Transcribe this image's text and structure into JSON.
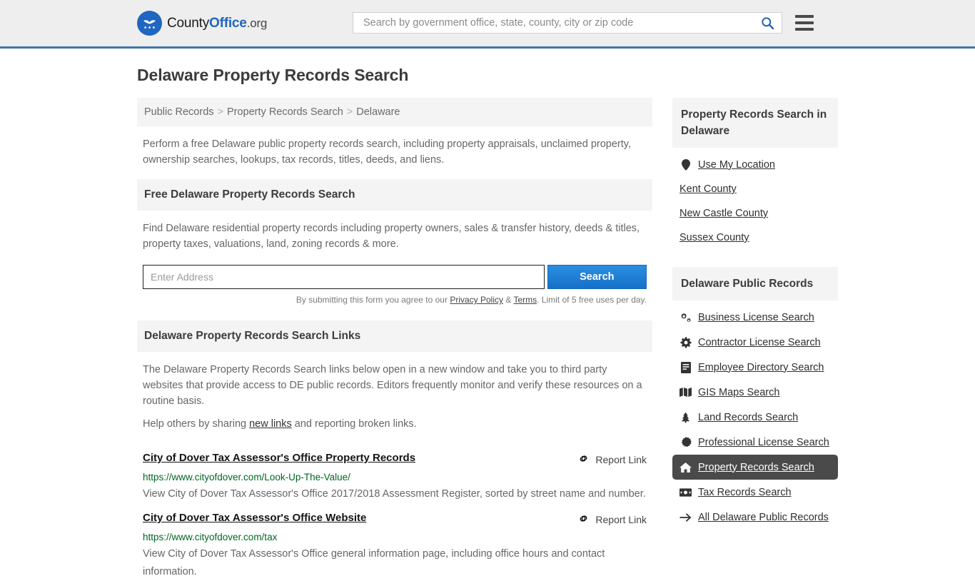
{
  "header": {
    "logo": {
      "icon": "eagle-shield-logo",
      "text_1": "County",
      "text_2": "Office",
      "text_3": ".org"
    },
    "search": {
      "placeholder": "Search by government office, state, county, city or zip code",
      "value": "",
      "icon": "search-icon"
    },
    "menu_icon": "hamburger-menu-icon",
    "accent_color": "#3a77ad"
  },
  "page": {
    "title": "Delaware Property Records Search"
  },
  "breadcrumb": {
    "items": [
      {
        "label": "Public Records"
      },
      {
        "label": "Property Records Search"
      },
      {
        "label": "Delaware"
      }
    ],
    "separator": ">"
  },
  "intro": {
    "text": "Perform a free Delaware public property records search, including property appraisals, unclaimed property, ownership searches, lookups, tax records, titles, deeds, and liens."
  },
  "free_search": {
    "heading": "Free Delaware Property Records Search",
    "description": "Find Delaware residential property records including property owners, sales & transfer history, deeds & titles, property taxes, valuations, land, zoning records & more.",
    "input_placeholder": "Enter Address",
    "input_value": "",
    "button_label": "Search",
    "button_color": "#1570c8",
    "legal_prefix": "By submitting this form you agree to our ",
    "legal_privacy": "Privacy Policy",
    "legal_amp": " & ",
    "legal_terms": "Terms",
    "legal_suffix": ". Limit of 5 free uses per day."
  },
  "links_section": {
    "heading": "Delaware Property Records Search Links",
    "paragraph_1": "The Delaware Property Records Search links below open in a new window and take you to third party websites that provide access to DE public records. Editors frequently monitor and verify these resources on a routine basis.",
    "help_prefix": "Help others by sharing ",
    "help_link": "new links",
    "help_suffix": " and reporting broken links.",
    "report_label": "Report Link",
    "report_icon": "broken-link-icon",
    "results": [
      {
        "title": "City of Dover Tax Assessor's Office Property Records",
        "url": "https://www.cityofdover.com/Look-Up-The-Value/",
        "description": "View City of Dover Tax Assessor's Office 2017/2018 Assessment Register, sorted by street name and number."
      },
      {
        "title": "City of Dover Tax Assessor's Office Website",
        "url": "https://www.cityofdover.com/tax",
        "description": "View City of Dover Tax Assessor's Office general information page, including office hours and contact information."
      }
    ],
    "url_color": "#006621"
  },
  "sidebar": {
    "counties_heading": "Property Records Search in Delaware",
    "counties": [
      {
        "label": "Use My Location",
        "icon": "map-pin-icon"
      },
      {
        "label": "Kent County",
        "icon": ""
      },
      {
        "label": "New Castle County",
        "icon": ""
      },
      {
        "label": "Sussex County",
        "icon": ""
      }
    ],
    "records_heading": "Delaware Public Records",
    "records": [
      {
        "label": "Business License Search",
        "icon": "cogs-icon",
        "active": false
      },
      {
        "label": "Contractor License Search",
        "icon": "cog-icon",
        "active": false
      },
      {
        "label": "Employee Directory Search",
        "icon": "book-icon",
        "active": false
      },
      {
        "label": "GIS Maps Search",
        "icon": "map-icon",
        "active": false
      },
      {
        "label": "Land Records Search",
        "icon": "tree-icon",
        "active": false
      },
      {
        "label": "Professional License Search",
        "icon": "certificate-icon",
        "active": false
      },
      {
        "label": "Property Records Search",
        "icon": "home-icon",
        "active": true
      },
      {
        "label": "Tax Records Search",
        "icon": "money-bill-icon",
        "active": false
      },
      {
        "label": "All Delaware Public Records",
        "icon": "arrow-right-icon",
        "active": false
      }
    ],
    "active_color": "#4a4a4a"
  }
}
